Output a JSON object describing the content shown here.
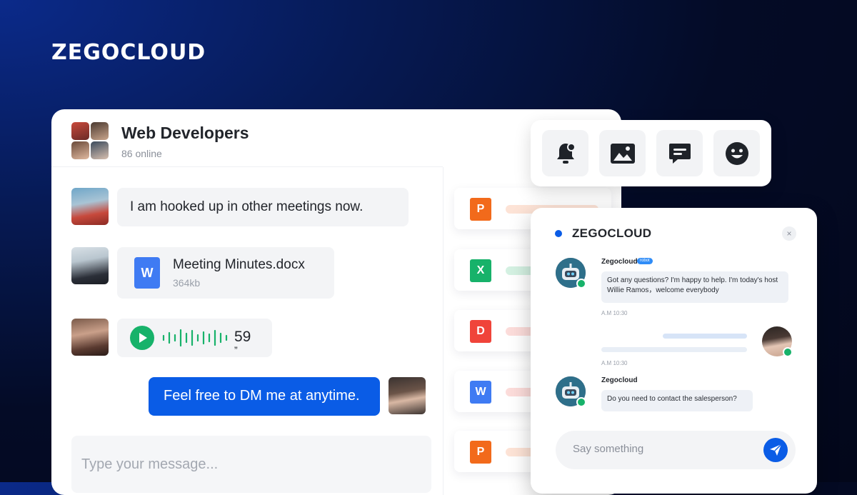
{
  "brand": {
    "logo_text": "ZEGOCLOUD"
  },
  "colors": {
    "accent": "#0a5ce6",
    "online": "#17b26a"
  },
  "chat": {
    "group_title": "Web Developers",
    "online_status": "86 online",
    "messages": [
      {
        "type": "text",
        "text": "I am hooked up in other meetings now."
      },
      {
        "type": "file",
        "file_icon_letter": "W",
        "file_name": "Meeting Minutes.docx",
        "file_size": "364kb"
      },
      {
        "type": "voice",
        "duration": "59",
        "quote_mark": "”"
      },
      {
        "type": "text",
        "outgoing": true,
        "text": "Feel free to DM me at anytime."
      }
    ],
    "input_placeholder": "Type your message..."
  },
  "files": [
    {
      "icon_letter": "P",
      "color": "#f26a1b"
    },
    {
      "icon_letter": "X",
      "color": "#17b26a"
    },
    {
      "icon_letter": "D",
      "color": "#f0443a"
    },
    {
      "icon_letter": "W",
      "color": "#3f7bf3"
    },
    {
      "icon_letter": "P",
      "color": "#f26a1b"
    }
  ],
  "toolbar": {
    "tools": [
      "bell-icon",
      "image-icon",
      "message-icon",
      "emoji-icon"
    ]
  },
  "bot_chat": {
    "title": "ZEGOCLOUD",
    "close_glyph": "×",
    "bot_name": "Zegocloud",
    "bot_tag": "robot",
    "greeting": "Got any questions? I'm happy to help. I'm today's host Willie Ramos，welcome everybody",
    "time_1": "A.M 10:30",
    "time_2": "A.M 10:30",
    "bot_name_2": "Zegocloud",
    "question": "Do you need to contact the salesperson?",
    "input_placeholder": "Say something"
  }
}
